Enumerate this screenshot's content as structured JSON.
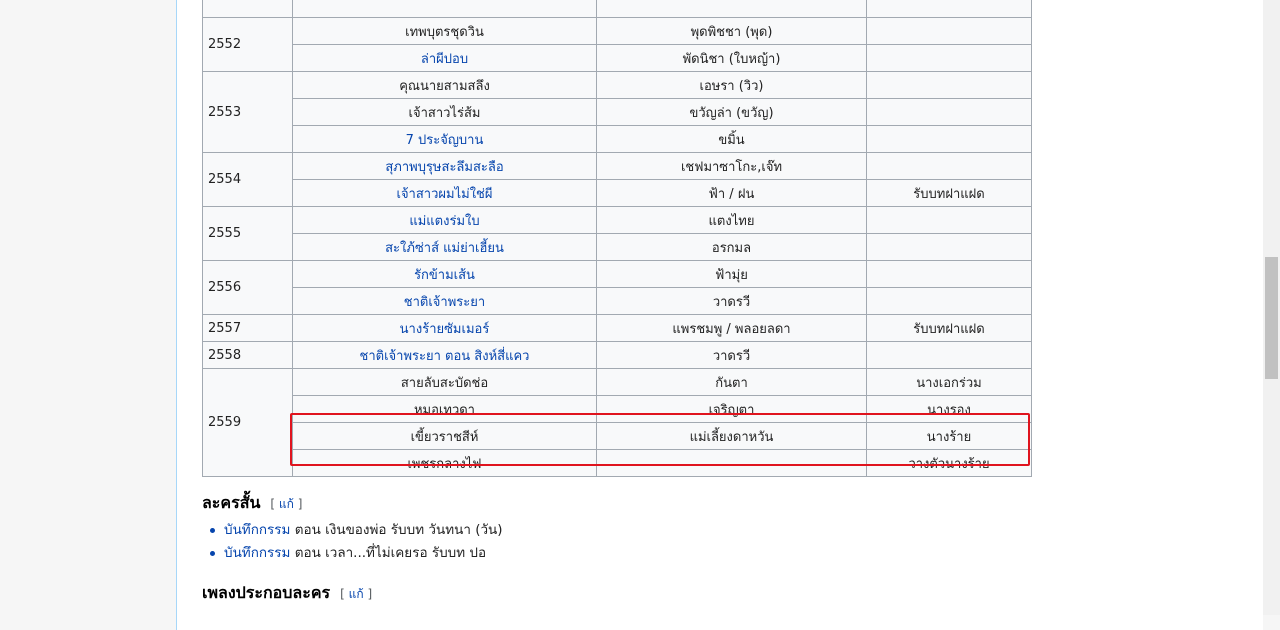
{
  "table": {
    "rows": [
      {
        "year": "",
        "title": "",
        "role": "",
        "note": ""
      },
      {
        "year": "2552",
        "title": "เทพบุตรชุดวิน",
        "role": "พุดพิชชา (พุด)",
        "note": "",
        "link": false
      },
      {
        "title": "ล่าผีปอบ",
        "role": "พัดนิชา (ใบหญ้า)",
        "note": "",
        "link": true
      },
      {
        "year": "2553",
        "title": "คุณนายสามสลึง",
        "role": "เอษรา (วิว)",
        "note": "",
        "link": false
      },
      {
        "title": "เจ้าสาวไร่ส้ม",
        "role": "ขวัญล่า (ขวัญ)",
        "note": "",
        "link": false
      },
      {
        "title": "7 ประจัญบาน",
        "role": "ขมิ้น",
        "note": "",
        "link": true
      },
      {
        "year": "2554",
        "title": "สุภาพบุรุษสะลึมสะลือ",
        "role": "เชฟมาซาโกะ,เจ๊ท",
        "note": "",
        "link": true
      },
      {
        "title": "เจ้าสาวผมไม่ใช่ผี",
        "role": "ฟ้า / ฝน",
        "note": "รับบทฝาแฝด",
        "link": true
      },
      {
        "year": "2555",
        "title": "แม่แตงร่มใบ",
        "role": "แตงไทย",
        "note": "",
        "link": true
      },
      {
        "title": "สะใภ้ซ่าส์ แม่ย่าเฮี้ยน",
        "role": "อรกมล",
        "note": "",
        "link": true
      },
      {
        "year": "2556",
        "title": "รักข้ามเส้น",
        "role": "ฟ้ามุ่ย",
        "note": "",
        "link": true
      },
      {
        "title": "ชาติเจ้าพระยา",
        "role": "วาดรวี",
        "note": "",
        "link": true
      },
      {
        "year": "2557",
        "title": "นางร้ายซัมเมอร์",
        "role": "แพรชมพู / พลอยลดา",
        "note": "รับบทฝาแฝด",
        "link": true
      },
      {
        "year": "2558",
        "title": "ชาติเจ้าพระยา ตอน สิงห์สี่แคว",
        "role": "วาดรวี",
        "note": "",
        "link": true
      },
      {
        "year": "2559",
        "title": "สายลับสะบัดช่อ",
        "role": "กันตา",
        "note": "นางเอกร่วม",
        "link": false
      },
      {
        "title": "หมอเทวดา",
        "role": "เจริญตา",
        "note": "นางรอง",
        "link": false
      },
      {
        "title": "เขี้ยวราชสีห์",
        "role": "แม่เลี้ยงดาหวัน",
        "note": "นางร้าย",
        "link": false
      },
      {
        "title": "เพชรกลางไฟ",
        "role": "",
        "note": "วางตัวนางร้าย",
        "link": false
      }
    ]
  },
  "short_dramas": {
    "heading": "ละครสั้น",
    "edit_open": "[ ",
    "edit_label": "แก้",
    "edit_close": " ]",
    "items": [
      {
        "link": "บันทึกกรรม",
        "rest": " ตอน เงินของพ่อ รับบท วันทนา (วัน)"
      },
      {
        "link": "บันทึกกรรม",
        "rest": " ตอน เวลา...ที่ไม่เคยรอ รับบท ปอ"
      }
    ]
  },
  "songs": {
    "heading": "เพลงประกอบละคร",
    "edit_open": "[ ",
    "edit_label": "แก้",
    "edit_close": " ]"
  },
  "colors": {
    "link": "#0645ad",
    "highlight": "#e0141e",
    "border": "#a2a9b1"
  }
}
